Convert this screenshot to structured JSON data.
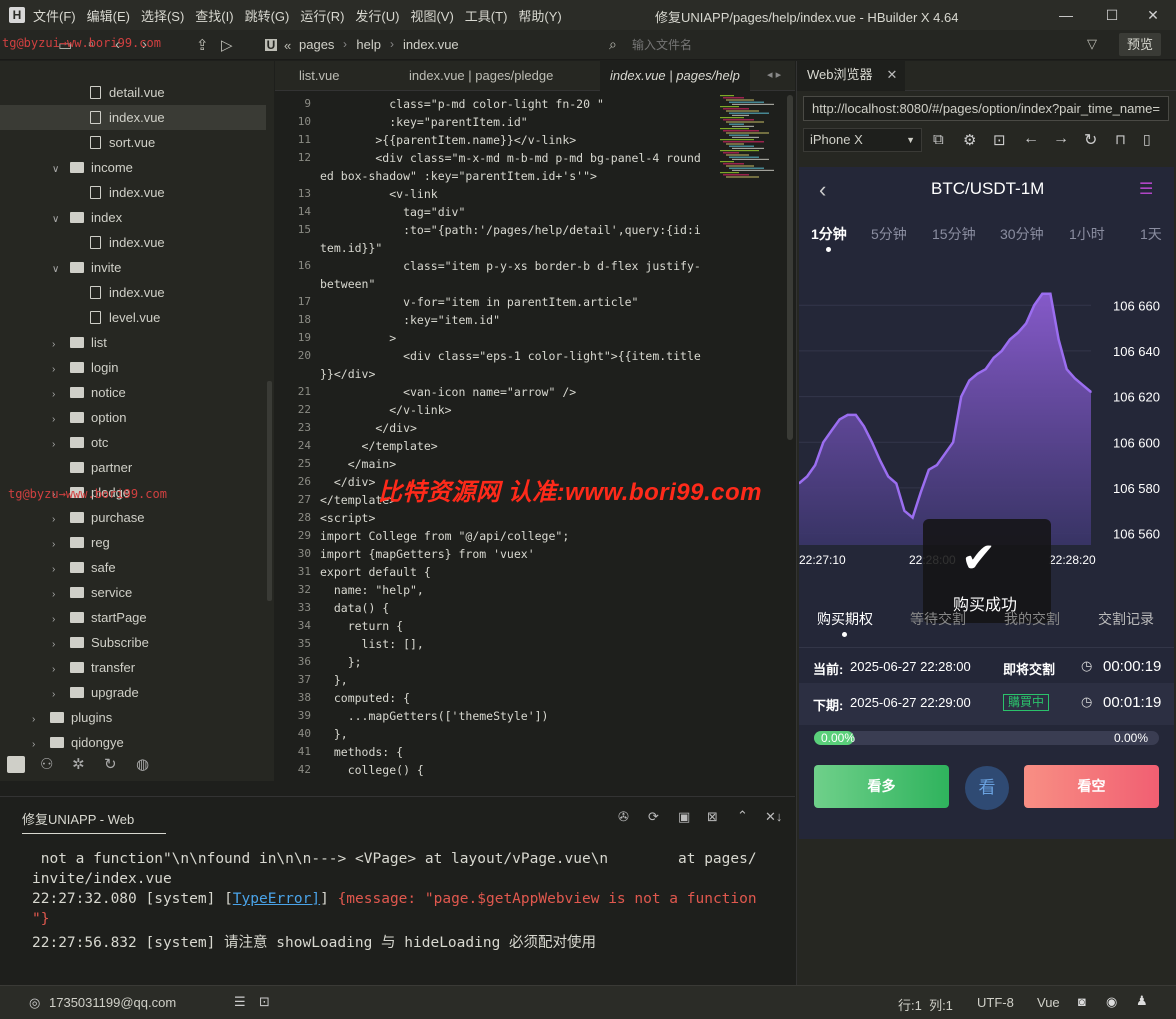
{
  "titlebar": {
    "menus": [
      "文件(F)",
      "编辑(E)",
      "选择(S)",
      "查找(I)",
      "跳转(G)",
      "运行(R)",
      "发行(U)",
      "视图(V)",
      "工具(T)",
      "帮助(Y)"
    ],
    "title": "修复UNIAPP/pages/help/index.vue - HBuilder X 4.64"
  },
  "toolbar": {
    "breadcrumb": [
      "pages",
      "help",
      "index.vue"
    ],
    "file_search_placeholder": "输入文件名",
    "preview_label": "预览"
  },
  "watermarks": {
    "main": "比特资源网 认准:www.bori99.com",
    "small1": "tg@byzui→ww.bori99.com",
    "small2": "tg@byzu→www.bori99.com"
  },
  "sidebar": {
    "items": [
      {
        "label": "detail.vue",
        "type": "file",
        "depth": 4
      },
      {
        "label": "index.vue",
        "type": "file",
        "depth": 4,
        "selected": true
      },
      {
        "label": "sort.vue",
        "type": "file",
        "depth": 4
      },
      {
        "label": "income",
        "type": "folder",
        "depth": 3,
        "open": true
      },
      {
        "label": "index.vue",
        "type": "file",
        "depth": 4
      },
      {
        "label": "index",
        "type": "folder",
        "depth": 3,
        "open": true
      },
      {
        "label": "index.vue",
        "type": "file",
        "depth": 4
      },
      {
        "label": "invite",
        "type": "folder",
        "depth": 3,
        "open": true
      },
      {
        "label": "index.vue",
        "type": "file",
        "depth": 4
      },
      {
        "label": "level.vue",
        "type": "file",
        "depth": 4
      },
      {
        "label": "list",
        "type": "folder",
        "depth": 3
      },
      {
        "label": "login",
        "type": "folder",
        "depth": 3
      },
      {
        "label": "notice",
        "type": "folder",
        "depth": 3
      },
      {
        "label": "option",
        "type": "folder",
        "depth": 3
      },
      {
        "label": "otc",
        "type": "folder",
        "depth": 3
      },
      {
        "label": "partner",
        "type": "folder",
        "depth": 3,
        "nochev": true
      },
      {
        "label": "pledge",
        "type": "folder",
        "depth": 3
      },
      {
        "label": "purchase",
        "type": "folder",
        "depth": 3
      },
      {
        "label": "reg",
        "type": "folder",
        "depth": 3
      },
      {
        "label": "safe",
        "type": "folder",
        "depth": 3
      },
      {
        "label": "service",
        "type": "folder",
        "depth": 3
      },
      {
        "label": "startPage",
        "type": "folder",
        "depth": 3
      },
      {
        "label": "Subscribe",
        "type": "folder",
        "depth": 3
      },
      {
        "label": "transfer",
        "type": "folder",
        "depth": 3
      },
      {
        "label": "upgrade",
        "type": "folder",
        "depth": 3
      },
      {
        "label": "plugins",
        "type": "folder",
        "depth": 2
      },
      {
        "label": "qidongye",
        "type": "folder",
        "depth": 2
      }
    ]
  },
  "editor": {
    "tabs": [
      "list.vue",
      "index.vue | pages/pledge",
      "index.vue | pages/help"
    ],
    "line_numbers": [
      "9",
      "10",
      "11",
      "12",
      "",
      "13",
      "14",
      "15",
      "",
      "16",
      "",
      "17",
      "18",
      "19",
      "20",
      "",
      "21",
      "22",
      "23",
      "24",
      "25",
      "26",
      "27",
      "28",
      "29",
      "30",
      "31",
      "32",
      "33",
      "34",
      "35",
      "36",
      "37",
      "38",
      "39",
      "40",
      "41",
      "42"
    ],
    "lines": [
      "          class=\"p-md color-light fn-20 \"",
      "          :key=\"parentItem.id\"",
      "        >{{parentItem.name}}</v-link>",
      "        <div class=\"m-x-md m-b-md p-md bg-panel-4 round",
      "ed box-shadow\" :key=\"parentItem.id+'s'\">",
      "          <v-link",
      "            tag=\"div\"",
      "            :to=\"{path:'/pages/help/detail',query:{id:i",
      "tem.id}}\"",
      "            class=\"item p-y-xs border-b d-flex justify-",
      "between\"",
      "            v-for=\"item in parentItem.article\"",
      "            :key=\"item.id\"",
      "          >",
      "            <div class=\"eps-1 color-light\">{{item.title",
      "}}</div>",
      "            <van-icon name=\"arrow\" />",
      "          </v-link>",
      "        </div>",
      "      </template>",
      "    </main>",
      "  </div>",
      "</template>",
      "<script>",
      "import College from \"@/api/college\";",
      "import {mapGetters} from 'vuex'",
      "export default {",
      "  name: \"help\",",
      "  data() {",
      "    return {",
      "      list: [],",
      "    };",
      "  },",
      "  computed: {",
      "    ...mapGetters(['themeStyle'])",
      "  },",
      "  methods: {",
      "    college() {"
    ]
  },
  "console": {
    "title": "修复UNIAPP - Web",
    "lines": [
      " not a function\"\\n\\nfound in\\n\\n---> <VPage> at layout/vPage.vue\\n        at pages/",
      "invite/index.vue",
      "22:27:32.080 [system] [TypeError] {message: \"page.$getAppWebview is not a function",
      "\"}",
      "22:27:56.832 [system] 请注意 showLoading 与 hideLoading 必须配对使用"
    ]
  },
  "statusbar": {
    "user": "1735031199@qq.com",
    "position": "行:1  列:1",
    "encoding": "UTF-8",
    "language": "Vue"
  },
  "browser": {
    "tab_label": "Web浏览器",
    "url": "http://localhost:8080/#/pages/option/index?pair_time_name=",
    "device": "iPhone X"
  },
  "app": {
    "title": "BTC/USDT-1M",
    "intervals": [
      "1分钟",
      "5分钟",
      "15分钟",
      "30分钟",
      "1小时",
      "1天"
    ],
    "y_ticks": [
      "106 660",
      "106 640",
      "106 620",
      "106 600",
      "106 580",
      "106 560"
    ],
    "x_ticks": [
      "22:27:10",
      "22:28:00",
      "22:28:20"
    ],
    "toast": "购买成功",
    "subtabs": [
      "购买期权",
      "等待交割",
      "我的交割",
      "交割记录"
    ],
    "current_label": "当前:",
    "current_time": "2025-06-27 22:28:00",
    "status_settle": "即将交割",
    "countdown1": "00:00:19",
    "next_label": "下期:",
    "next_time": "2025-06-27 22:29:00",
    "status_buying": "購買中",
    "countdown2": "00:01:19",
    "progress_left": "0.00%",
    "progress_right": "0.00%",
    "progress": 0.0,
    "btn_long": "看多",
    "btn_mid": "看",
    "btn_short": "看空"
  },
  "chart_data": {
    "type": "area",
    "x_ticks": [
      "22:27:10",
      "22:28:00",
      "22:28:20"
    ],
    "ylim": [
      106555,
      106668
    ],
    "y_ticks": [
      106660,
      106640,
      106620,
      106600,
      106580,
      106560
    ],
    "values": [
      106582,
      106585,
      106590,
      106600,
      106605,
      106610,
      106612,
      106612,
      106607,
      106600,
      106592,
      106585,
      106582,
      106570,
      106567,
      106578,
      106588,
      106590,
      106595,
      106600,
      106620,
      106627,
      106630,
      106632,
      106637,
      106640,
      106645,
      106648,
      106652,
      106660,
      106665,
      106665,
      106645,
      106632,
      106628,
      106625,
      106622
    ]
  }
}
